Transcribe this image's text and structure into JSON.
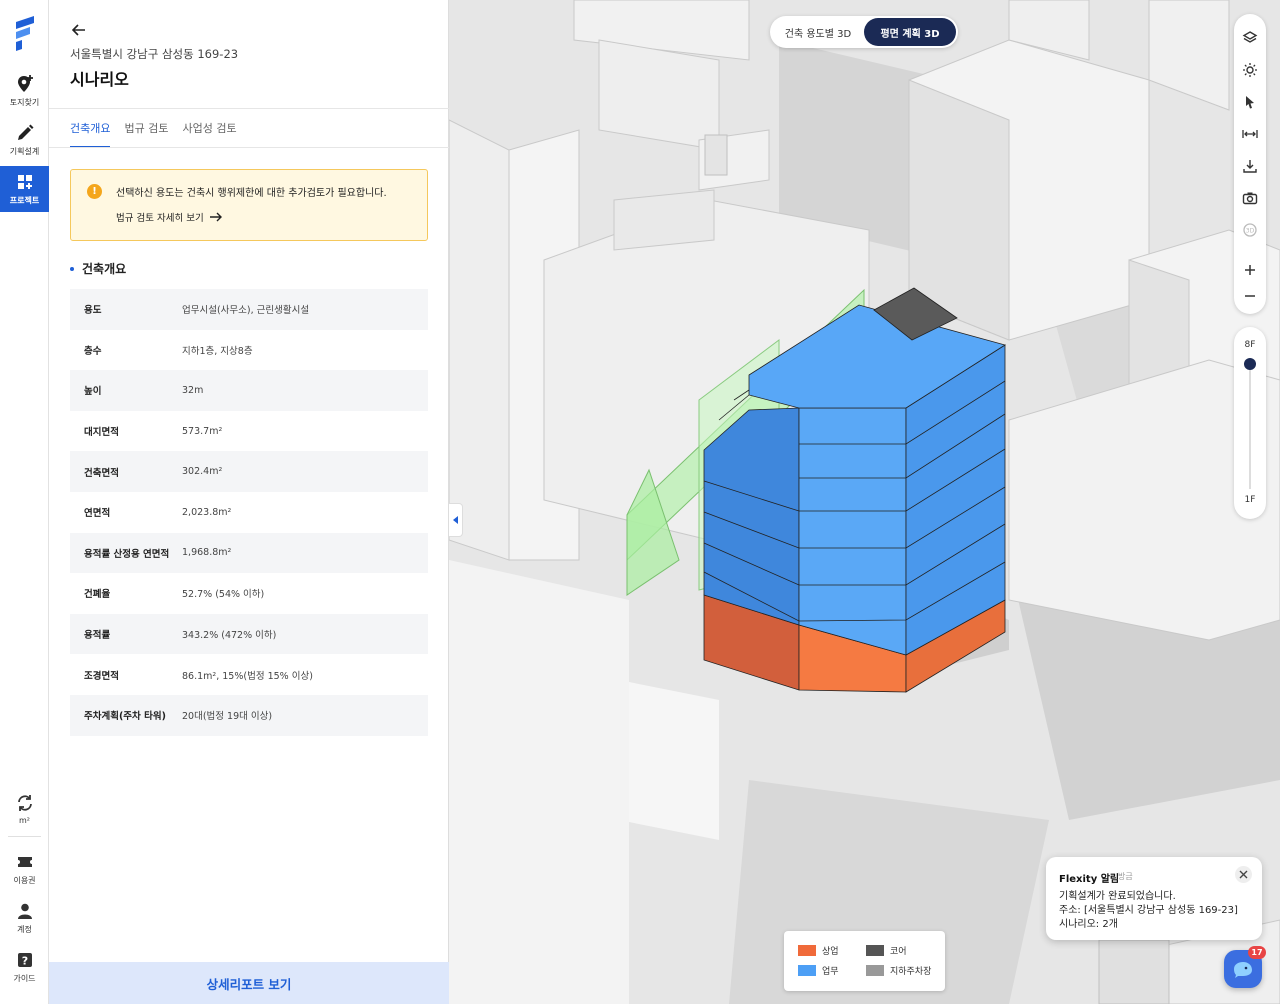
{
  "rail": {
    "items": [
      {
        "label": "토지찾기",
        "icon": "map-pin-plus-icon"
      },
      {
        "label": "기획설계",
        "icon": "pencil-icon"
      },
      {
        "label": "프로젝트",
        "icon": "grid-plus-icon",
        "active": true
      }
    ],
    "bottom": [
      {
        "label": "m²",
        "icon": "unit-swap-icon"
      },
      {
        "label": "이용권",
        "icon": "ticket-icon"
      },
      {
        "label": "계정",
        "icon": "person-icon"
      },
      {
        "label": "가이드",
        "icon": "help-icon"
      }
    ]
  },
  "panel": {
    "address": "서울특별시 강남구 삼성동 169-23",
    "scenario": "시나리오",
    "tabs": [
      "건축개요",
      "법규 검토",
      "사업성 검토"
    ],
    "notice": {
      "message": "선택하신 용도는 건축시 행위제한에 대한 추가검토가 필요합니다.",
      "link": "법규 검토 자세히 보기"
    },
    "section_title": "건축개요",
    "specs": [
      {
        "k": "용도",
        "v": "업무시설(사무소), 근린생활시설"
      },
      {
        "k": "층수",
        "v": "지하1층, 지상8층"
      },
      {
        "k": "높이",
        "v": "32m"
      },
      {
        "k": "대지면적",
        "v": "573.7m²"
      },
      {
        "k": "건축면적",
        "v": "302.4m²"
      },
      {
        "k": "연면적",
        "v": "2,023.8m²"
      },
      {
        "k": "용적률 산정용 연면적",
        "v": "1,968.8m²"
      },
      {
        "k": "건폐율",
        "v": "52.7% (54% 이하)"
      },
      {
        "k": "용적률",
        "v": "343.2% (472% 이하)"
      },
      {
        "k": "조경면적",
        "v": "86.1m², 15%(법정 15% 이상)"
      },
      {
        "k": "주차계획(주차 타워)",
        "v": "20대(법정 19대 이상)"
      }
    ],
    "report_button": "상세리포트 보기"
  },
  "map": {
    "view_toggle": [
      "건축 용도별 3D",
      "평면 계획 3D"
    ],
    "tools": [
      "layers-icon",
      "sun-icon",
      "cursor-icon",
      "measure-icon",
      "download-icon",
      "camera-icon",
      "rotate-3d-icon",
      "zoom-in-icon",
      "zoom-out-icon"
    ],
    "floor_top": "8F",
    "floor_bottom": "1F",
    "legend": [
      {
        "label": "상업",
        "color": "#f06a3a"
      },
      {
        "label": "코어",
        "color": "#555555"
      },
      {
        "label": "업무",
        "color": "#4d9ff5"
      },
      {
        "label": "지하주차장",
        "color": "#999999"
      }
    ]
  },
  "toast": {
    "title": "Flexity 알림",
    "time": "방금",
    "lines": [
      "기획설계가 완료되었습니다.",
      "주소: [서울특별시 강남구 삼성동 169-23]",
      "시나리오: 2개"
    ]
  },
  "chat": {
    "badge": "17"
  },
  "colors": {
    "accent": "#1f5fd6",
    "navy": "#1b2a55",
    "office": "#4d9ff5",
    "commercial": "#f06a3a",
    "core": "#555555"
  }
}
